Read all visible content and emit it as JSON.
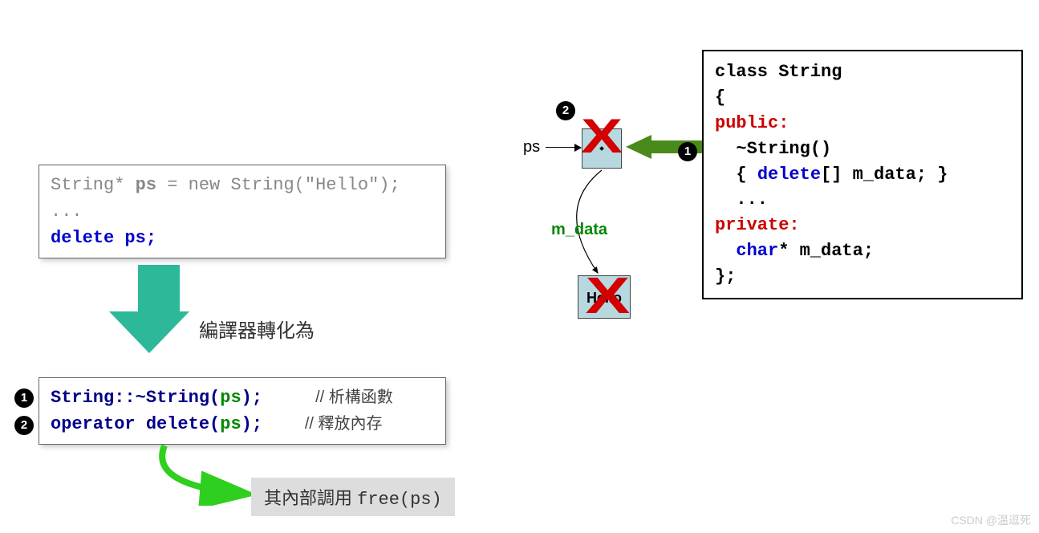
{
  "box1": {
    "line1a": "String* ",
    "line1b": "ps",
    "line1c": " = new String(\"Hello\");",
    "line2": "...",
    "line3a": "delete ",
    "line3b": "ps;"
  },
  "compiler_text": "編譯器轉化為",
  "box2": {
    "l1a": "String::~String",
    "l1b": "(",
    "l1c": "ps",
    "l1d": ");",
    "l1comment": "//  析構函數",
    "l2a": "operator delete",
    "l2b": "(",
    "l2c": "ps",
    "l2d": ");",
    "l2comment": "//  釋放內存"
  },
  "bottom_grey": {
    "text": "其內部調用 ",
    "code": "free(ps)"
  },
  "box3": {
    "l1": "class String",
    "l2": "{",
    "l3": "public:",
    "l4a": "  ~String()",
    "l4b_open": "  { ",
    "l4b_del": "delete",
    "l4b_rest": "[] m_data; }",
    "l5": "  ...",
    "l6": "private:",
    "l7a": "  ",
    "l7b": "char",
    "l7c": "* m_data;",
    "l8": "};"
  },
  "mid": {
    "ps_label": "ps",
    "mdata_label": "m_data",
    "hello_text": "Hello"
  },
  "numbers": {
    "n1": "1",
    "n2": "2"
  },
  "watermark": "CSDN @温逗死"
}
